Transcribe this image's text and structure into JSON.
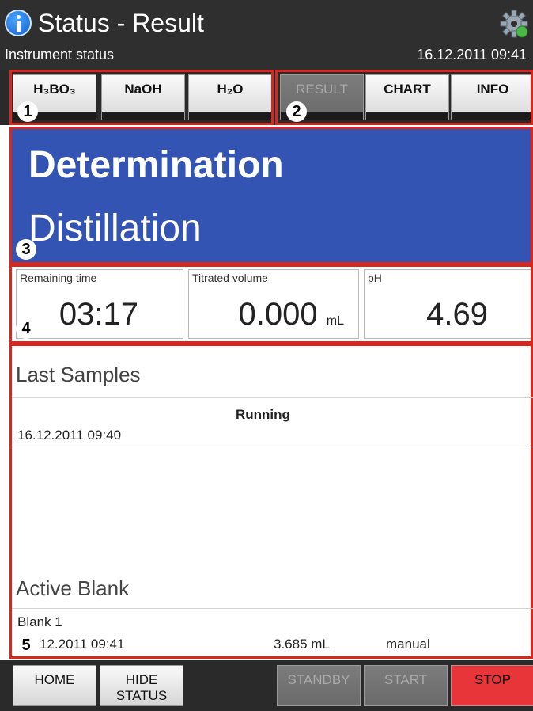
{
  "header": {
    "title": "Status - Result",
    "subtitle": "Instrument status",
    "datetime": "16.12.2011 09:41",
    "info_icon": "info-icon",
    "settings_icon": "gear-icon"
  },
  "tabs": {
    "reagents": [
      "H₃BO₃",
      "NaOH",
      "H₂O"
    ],
    "views": [
      {
        "label": "RESULT",
        "state": "disabled"
      },
      {
        "label": "CHART",
        "state": "enabled"
      },
      {
        "label": "INFO",
        "state": "enabled"
      }
    ]
  },
  "callouts": [
    "1",
    "2",
    "3",
    "4",
    "5"
  ],
  "banner": {
    "line1": "Determination",
    "line2": "Distillation",
    "color": "#3454b4"
  },
  "values": {
    "remaining": {
      "label": "Remaining time",
      "value": "03:17"
    },
    "titrated": {
      "label": "Titrated volume",
      "value": "0.000",
      "unit": "mL"
    },
    "ph": {
      "label": "pH",
      "value": "4.69"
    }
  },
  "last_samples": {
    "title": "Last Samples",
    "rows": [
      {
        "status": "Running",
        "datetime": "16.12.2011 09:40"
      }
    ]
  },
  "active_blank": {
    "title": "Active Blank",
    "name": "Blank 1",
    "datetime": "12.2011 09:41",
    "volume": "3.685 mL",
    "mode": "manual"
  },
  "bottom": {
    "home": "HOME",
    "hide_status_1": "HIDE",
    "hide_status_2": "STATUS",
    "standby": "STANDBY",
    "start": "START",
    "stop": "STOP",
    "stop_color": "#e8353a"
  }
}
